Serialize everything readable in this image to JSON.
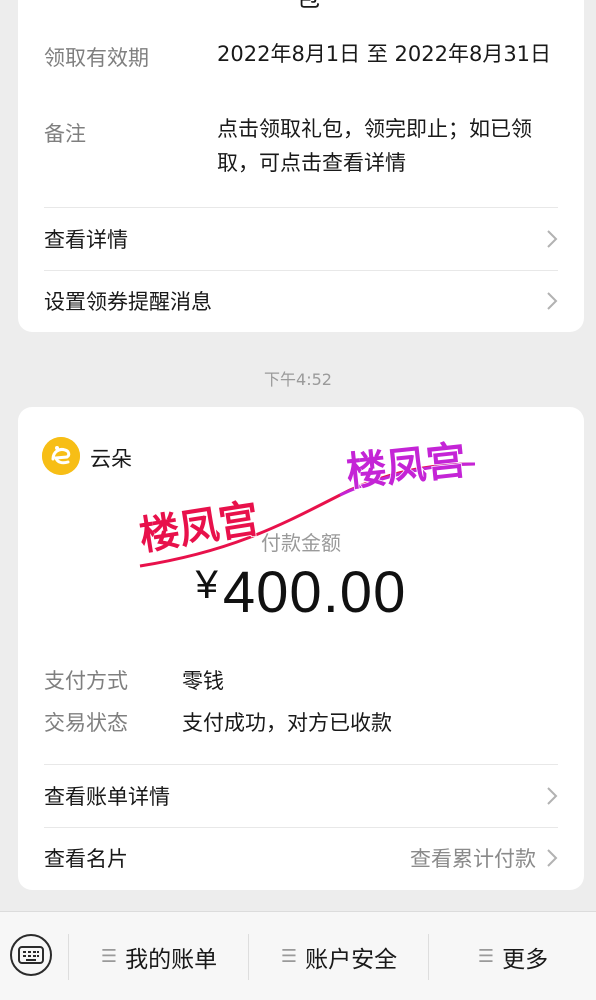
{
  "top_card": {
    "title_fragment": "包",
    "validity_label": "领取有效期",
    "validity_value": "2022年8月1日 至 2022年8月31日",
    "note_label": "备注",
    "note_value": "点击领取礼包，领完即止；如已领取，可点击查看详情",
    "rows": [
      {
        "label": "查看详情"
      },
      {
        "label": "设置领券提醒消息"
      }
    ]
  },
  "timestamp": "下午4:52",
  "payment_card": {
    "merchant_name": "云朵",
    "amount_title": "付款金额",
    "currency": "¥",
    "amount": "400.00",
    "details": [
      {
        "label": "支付方式",
        "value": "零钱"
      },
      {
        "label": "交易状态",
        "value": "支付成功，对方已收款"
      }
    ],
    "rows": [
      {
        "label": "查看账单详情",
        "extra": ""
      },
      {
        "label": "查看名片",
        "extra": "查看累计付款"
      }
    ]
  },
  "watermark": {
    "text": "楼凤宫",
    "colors": [
      "#e8114b",
      "#c424d6"
    ]
  },
  "bottom_menu": {
    "items": [
      {
        "label": "我的账单"
      },
      {
        "label": "账户安全"
      },
      {
        "label": "更多"
      }
    ]
  },
  "icons": [
    "chevron-right-icon",
    "keyboard-icon",
    "menu-lines-icon",
    "cloud-logo-icon"
  ]
}
